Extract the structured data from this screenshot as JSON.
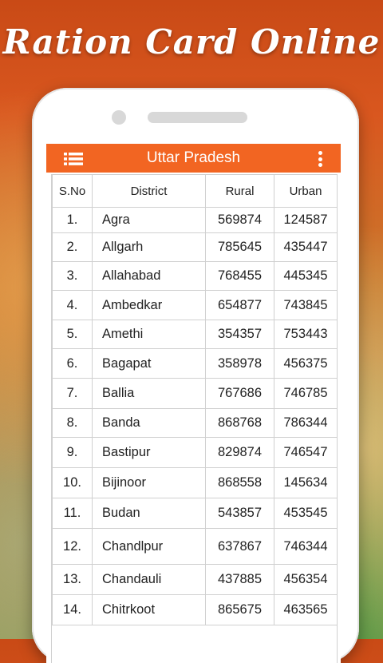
{
  "promo": {
    "title": "Ration Card Online"
  },
  "app": {
    "title": "Uttar Pradesh",
    "menu_icon": "hamburger-menu-icon",
    "more_icon": "more-vert-icon",
    "accent": "#f26522"
  },
  "table": {
    "headers": {
      "sno": "S.No",
      "district": "District",
      "rural": "Rural",
      "urban": "Urban"
    },
    "rows": [
      {
        "sno": "1.",
        "district": "Agra",
        "rural": "569874",
        "urban": "124587"
      },
      {
        "sno": "2.",
        "district": "Allgarh",
        "rural": "785645",
        "urban": "435447"
      },
      {
        "sno": "3.",
        "district": "Allahabad",
        "rural": "768455",
        "urban": "445345"
      },
      {
        "sno": "4.",
        "district": "Ambedkar",
        "rural": "654877",
        "urban": "743845"
      },
      {
        "sno": "5.",
        "district": "Amethi",
        "rural": "354357",
        "urban": "753443"
      },
      {
        "sno": "6.",
        "district": "Bagapat",
        "rural": "358978",
        "urban": "456375"
      },
      {
        "sno": "7.",
        "district": "Ballia",
        "rural": "767686",
        "urban": "746785"
      },
      {
        "sno": "8.",
        "district": "Banda",
        "rural": "868768",
        "urban": "786344"
      },
      {
        "sno": "9.",
        "district": "Bastipur",
        "rural": "829874",
        "urban": "746547"
      },
      {
        "sno": "10.",
        "district": "Bijinoor",
        "rural": "868558",
        "urban": "145634"
      },
      {
        "sno": "11.",
        "district": "Budan",
        "rural": "543857",
        "urban": "453545"
      },
      {
        "sno": "12.",
        "district": "Chandlpur",
        "rural": "637867",
        "urban": "746344"
      },
      {
        "sno": "13.",
        "district": "Chandauli",
        "rural": "437885",
        "urban": "456354"
      },
      {
        "sno": "14.",
        "district": "Chitrkoot",
        "rural": "865675",
        "urban": "463565"
      }
    ]
  }
}
